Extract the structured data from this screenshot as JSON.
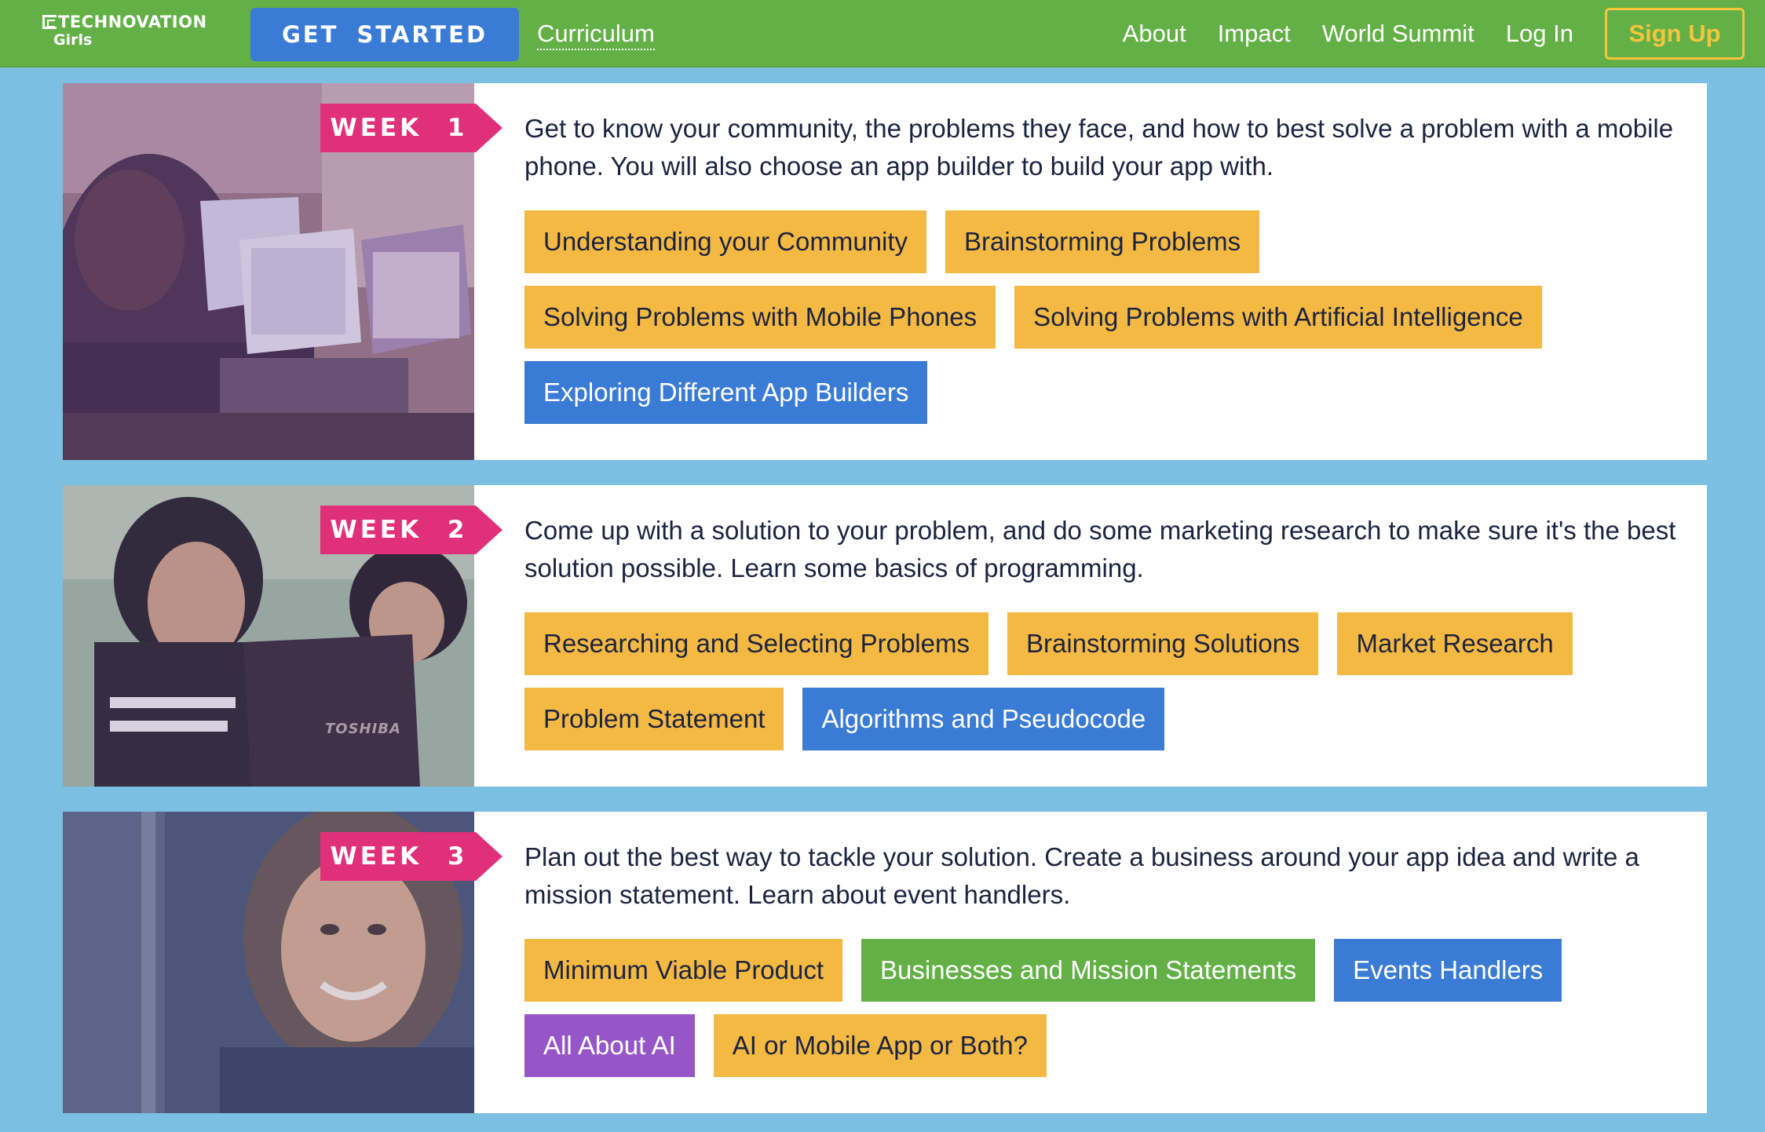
{
  "nav": {
    "logo_text": "TECHNOVATION",
    "logo_sub": "Girls",
    "get_started": "GET STARTED",
    "curriculum": "Curriculum",
    "links": [
      "About",
      "Impact",
      "World Summit",
      "Log In"
    ],
    "signup": "Sign Up"
  },
  "colors": {
    "nav_green": "#63b046",
    "page_blue": "#7bbfe3",
    "week_pink": "#e0307a",
    "tag_yellow": "#f4b942",
    "tag_blue": "#3a7bd5",
    "tag_green": "#63b046",
    "tag_purple": "#9656c8"
  },
  "weeks": [
    {
      "label": "WEEK 1",
      "description": "Get to know your community, the problems they face, and how to best solve a problem with a mobile phone. You will also choose an app builder to build your app with.",
      "topics": [
        {
          "label": "Understanding your Community",
          "color": "yellow"
        },
        {
          "label": "Brainstorming Problems",
          "color": "yellow"
        },
        {
          "label": "Solving Problems with Mobile Phones",
          "color": "yellow"
        },
        {
          "label": "Solving Problems with Artificial Intelligence",
          "color": "yellow"
        },
        {
          "label": "Exploring Different App Builders",
          "color": "blue"
        }
      ]
    },
    {
      "label": "WEEK 2",
      "description": "Come up with a solution to your problem, and do some marketing research to make sure it's the best solution possible. Learn some basics of programming.",
      "photo_text": "TOSHIBA",
      "topics": [
        {
          "label": "Researching and Selecting Problems",
          "color": "yellow"
        },
        {
          "label": "Brainstorming Solutions",
          "color": "yellow"
        },
        {
          "label": "Market Research",
          "color": "yellow"
        },
        {
          "label": "Problem Statement",
          "color": "yellow"
        },
        {
          "label": "Algorithms and Pseudocode",
          "color": "blue"
        }
      ]
    },
    {
      "label": "WEEK 3",
      "description": "Plan out the best way to tackle your solution. Create a business around your app idea and write a mission statement. Learn about event handlers.",
      "topics": [
        {
          "label": "Minimum Viable Product",
          "color": "yellow"
        },
        {
          "label": "Businesses and Mission Statements",
          "color": "green"
        },
        {
          "label": "Events Handlers",
          "color": "blue"
        },
        {
          "label": "All About AI",
          "color": "purple"
        },
        {
          "label": "AI or Mobile App or Both?",
          "color": "yellow"
        }
      ]
    }
  ]
}
